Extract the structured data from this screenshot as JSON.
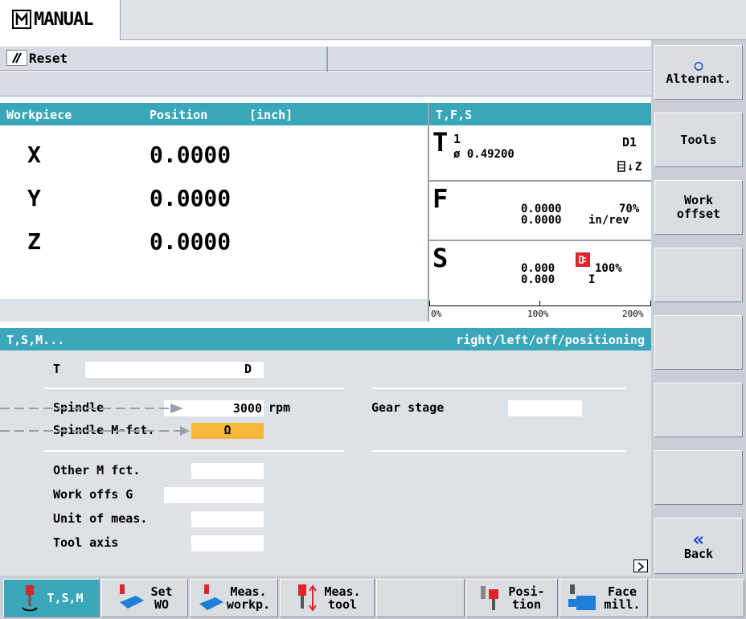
{
  "title_bar": {
    "mode_label": "MANUAL"
  },
  "status": {
    "reset_label": "Reset"
  },
  "workpiece": {
    "col1": "Workpiece",
    "col2": "Position",
    "unit": "[inch]",
    "axes": [
      {
        "name": "X",
        "value": "0.0000"
      },
      {
        "name": "Y",
        "value": "0.0000"
      },
      {
        "name": "Z",
        "value": "0.0000"
      }
    ]
  },
  "tfs": {
    "header": "T,F,S",
    "t_label": "T",
    "tool_number": "1",
    "diameter": "ø 0.49200",
    "d_label": "D1",
    "axis_label": "Z",
    "f_label": "F",
    "f_value1": "0.0000",
    "f_value2": "0.0000",
    "f_override": "70%",
    "f_unit": "in/rev",
    "s_label": "S",
    "s_value1": "0.000",
    "s_value2": "0.000",
    "s_override": "100%",
    "s_gear": "I",
    "scale_0": "0%",
    "scale_100": "100%",
    "scale_200": "200%"
  },
  "tsm": {
    "header": "T,S,M...",
    "hint": "right/left/off/positioning",
    "t_label": "T",
    "d_label": "D",
    "spindle_label": "Spindle",
    "spindle_value": "3000",
    "spindle_unit": "rpm",
    "gear_label": "Gear stage",
    "spindle_mfct_label": "Spindle M-fct.",
    "spindle_mfct_value": "Ω",
    "other_m_label": "Other M fct.",
    "work_offs_label": "Work offs G",
    "unit_label": "Unit of meas.",
    "tool_axis_label": "Tool axis"
  },
  "vertical_softkeys": {
    "alternat": "Alternat.",
    "tools": "Tools",
    "work_offset_1": "Work",
    "work_offset_2": "offset",
    "back_symbol": "«",
    "back": "Back"
  },
  "horizontal_softkeys": {
    "tsm": "T,S,M",
    "set_wo_1": "Set",
    "set_wo_2": "WO",
    "meas_workp_1": "Meas.",
    "meas_workp_2": "workp.",
    "meas_tool_1": "Meas.",
    "meas_tool_2": "tool",
    "position_1": "Posi-",
    "position_2": "tion",
    "face_mill_1": "Face",
    "face_mill_2": "mill."
  },
  "colors": {
    "accent_teal": "#3aa6b9",
    "selection_orange": "#f5b73a",
    "spindle_red": "#e0242a"
  }
}
